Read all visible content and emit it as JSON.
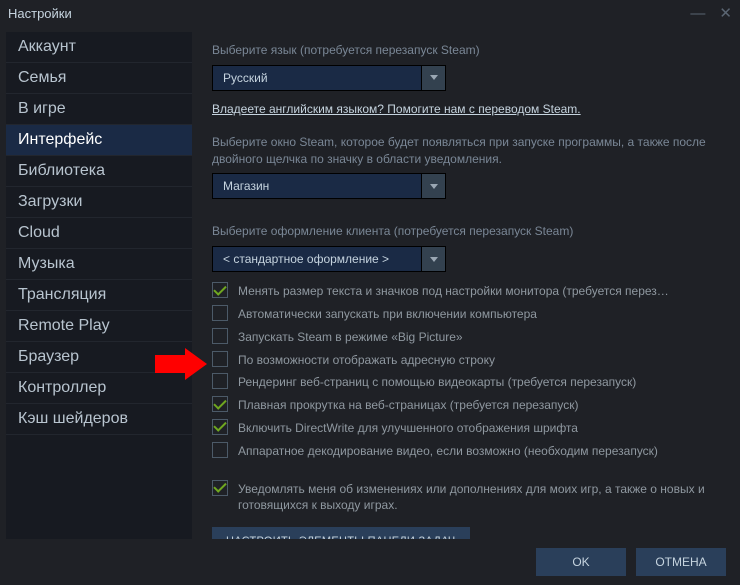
{
  "window": {
    "title": "Настройки"
  },
  "sidebar": {
    "items": [
      {
        "label": "Аккаунт"
      },
      {
        "label": "Семья"
      },
      {
        "label": "В игре"
      },
      {
        "label": "Интерфейс"
      },
      {
        "label": "Библиотека"
      },
      {
        "label": "Загрузки"
      },
      {
        "label": "Cloud"
      },
      {
        "label": "Музыка"
      },
      {
        "label": "Трансляция"
      },
      {
        "label": "Remote Play"
      },
      {
        "label": "Браузер"
      },
      {
        "label": "Контроллер"
      },
      {
        "label": "Кэш шейдеров"
      }
    ],
    "active_index": 3
  },
  "content": {
    "lang_label": "Выберите язык (потребуется перезапуск Steam)",
    "lang_value": "Русский",
    "translate_link": "Владеете английским языком? Помогите нам с переводом Steam.",
    "window_label": "Выберите окно Steam, которое будет появляться при запуске программы, а также после двойного щелчка по значку в области уведомления.",
    "window_value": "Магазин",
    "skin_label": "Выберите оформление клиента (потребуется перезапуск Steam)",
    "skin_value": "< стандартное оформление >",
    "checks": [
      {
        "checked": true,
        "label": "Менять размер текста и значков под настройки монитора (требуется перез…"
      },
      {
        "checked": false,
        "label": "Автоматически запускать при включении компьютера"
      },
      {
        "checked": false,
        "label": "Запускать Steam в режиме «Big Picture»"
      },
      {
        "checked": false,
        "label": "По возможности отображать адресную строку"
      },
      {
        "checked": false,
        "label": "Рендеринг веб-страниц с помощью видеокарты (требуется перезапуск)"
      },
      {
        "checked": true,
        "label": "Плавная прокрутка на веб-страницах (требуется перезапуск)"
      },
      {
        "checked": true,
        "label": "Включить DirectWrite для улучшенного отображения шрифта"
      },
      {
        "checked": false,
        "label": "Аппаратное декодирование видео, если возможно (необходим перезапуск)"
      }
    ],
    "notify_check": {
      "checked": true,
      "label": "Уведомлять меня об изменениях или дополнениях для моих игр, а также о новых и готовящихся к выходу играх."
    },
    "taskbar_button": "НАСТРОИТЬ ЭЛЕМЕНТЫ ПАНЕЛИ ЗАДАЧ"
  },
  "footer": {
    "ok": "OK",
    "cancel": "ОТМЕНА"
  }
}
